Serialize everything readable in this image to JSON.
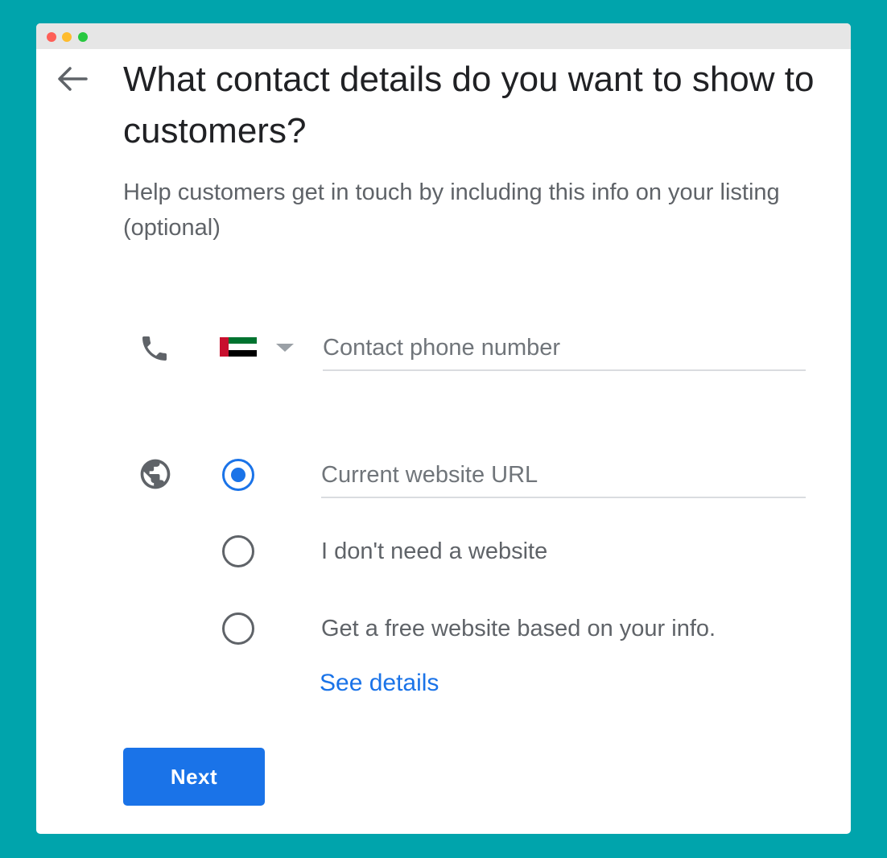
{
  "page": {
    "title": "What contact details do you want to show to customers?",
    "subtitle": "Help customers get in touch by including this info on your listing (optional)"
  },
  "phone": {
    "icon": "phone-icon",
    "country_flag": "uae-flag-icon",
    "placeholder": "Contact phone number",
    "value": ""
  },
  "website": {
    "icon": "globe-icon",
    "selected": "current_url",
    "url_placeholder": "Current website URL",
    "url_value": "",
    "option_no_website": "I don't need a website",
    "option_free_website": "Get a free website based on your info.",
    "see_details_label": "See details"
  },
  "actions": {
    "next_label": "Next"
  },
  "colors": {
    "background": "#00a4ac",
    "accent": "#1a73e8",
    "title_text": "#202124",
    "secondary_text": "#5f6368",
    "flag_red": "#c8102e",
    "flag_green": "#00732f",
    "flag_white": "#ffffff",
    "flag_black": "#000000"
  }
}
